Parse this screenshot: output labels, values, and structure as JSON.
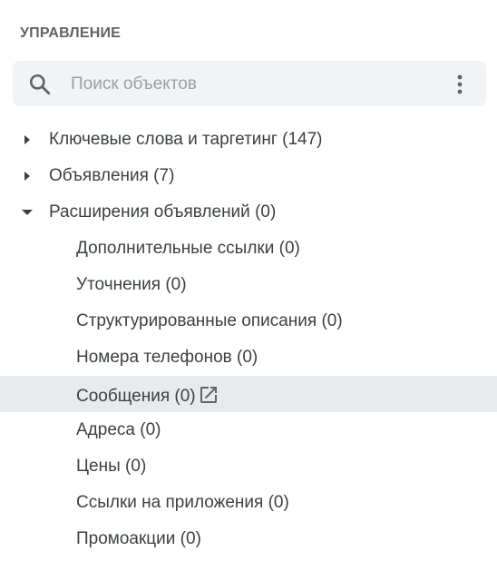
{
  "header": {
    "title": "УПРАВЛЕНИЕ"
  },
  "search": {
    "placeholder": "Поиск объектов",
    "value": "",
    "icon": "search-icon",
    "more_icon": "more-vert-icon"
  },
  "tree": {
    "keywords": {
      "label": "Ключевые слова и таргетинг (147)",
      "expanded": false
    },
    "ads": {
      "label": "Объявления (7)",
      "expanded": false
    },
    "extensions": {
      "label": "Расширения объявлений (0)",
      "expanded": true
    },
    "children": [
      {
        "label": "Дополнительные ссылки (0)"
      },
      {
        "label": "Уточнения (0)"
      },
      {
        "label": "Структурированные описания (0)"
      },
      {
        "label": "Номера телефонов (0)"
      },
      {
        "label": "Сообщения (0)",
        "selected": true,
        "icon": "open-in-new-icon"
      },
      {
        "label": "Адреса (0)"
      },
      {
        "label": "Цены (0)"
      },
      {
        "label": "Ссылки на приложения (0)"
      },
      {
        "label": "Промоакции (0)"
      }
    ]
  },
  "colors": {
    "text": "#3c4043",
    "muted": "#5f6368",
    "placeholder": "#9aa0a6",
    "search_bg": "#f1f3f4",
    "selected_bg": "#e8eaed"
  }
}
